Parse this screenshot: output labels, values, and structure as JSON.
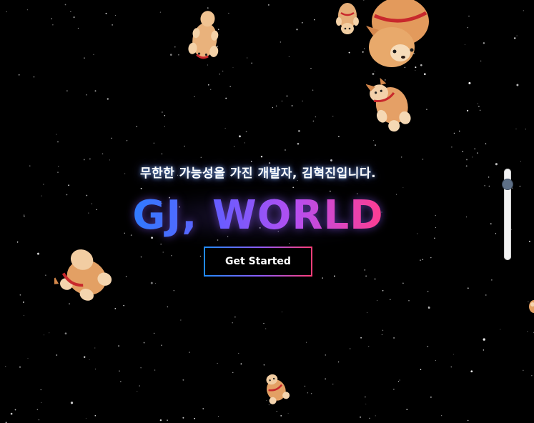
{
  "hero": {
    "subtitle": "무한한 가능성을 가진 개발자, 김혁진입니다.",
    "title": "GJ, WORLD",
    "cta_label": "Get Started"
  },
  "background": {
    "color": "#000000",
    "decorations": [
      "star-icon",
      "shiba-dog-icon"
    ]
  },
  "colors": {
    "title_gradient": [
      "#2f7bff",
      "#6a5cff",
      "#b64ef0",
      "#ff3d8f"
    ],
    "button_border_gradient": [
      "#1f8bff",
      "#8a5cff",
      "#ff3d77"
    ],
    "dog_body": "#e4a46c",
    "dog_collar": "#c8282c"
  },
  "scroll_slider": {
    "position_fraction": 0.15
  }
}
